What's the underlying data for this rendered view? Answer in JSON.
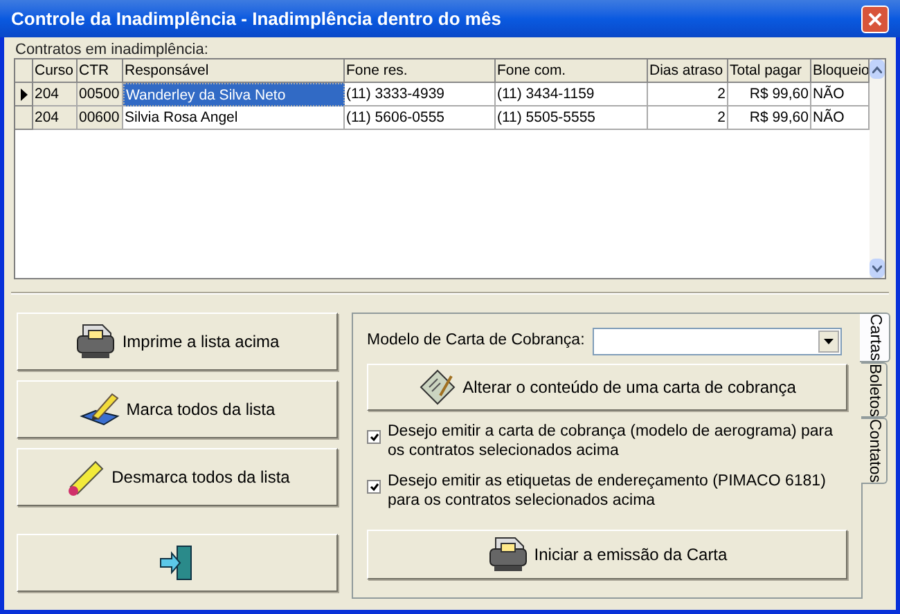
{
  "window": {
    "title": "Controle da Inadimplência - Inadimplência dentro do mês"
  },
  "grid_label": "Contratos em inadimplência:",
  "table": {
    "columns": [
      "Curso",
      "CTR",
      "Responsável",
      "Fone res.",
      "Fone com.",
      "Dias atraso",
      "Total pagar",
      "Bloqueio"
    ],
    "rows": [
      {
        "selected": true,
        "cells": [
          "204",
          "00500",
          "Wanderley da Silva Neto",
          "(11) 3333-4939",
          "(11) 3434-1159",
          "2",
          "R$ 99,60",
          "NÃO"
        ]
      },
      {
        "selected": false,
        "cells": [
          "204",
          "00600",
          "Silvia Rosa Angel",
          "(11) 5606-0555",
          "(11) 5505-5555",
          "2",
          "R$ 99,60",
          "NÃO"
        ]
      }
    ]
  },
  "left_buttons": [
    {
      "kind": "printer",
      "label": "Imprime a lista acima"
    },
    {
      "kind": "mark",
      "label": "Marca todos da lista"
    },
    {
      "kind": "pencil",
      "label": "Desmarca todos da lista"
    },
    {
      "kind": "exit"
    }
  ],
  "letter_panel": {
    "model_label": "Modelo de Carta de Cobrança:",
    "edit_button": "Alterar o conteúdo de uma carta de cobrança",
    "options": [
      {
        "label": "Desejo emitir a carta de cobrança (modelo de aerograma) para os contratos selecionados acima",
        "checked": true
      },
      {
        "label": "Desejo emitir as etiquetas de endereçamento (PIMACO 6181) para os contratos selecionados acima",
        "checked": true
      }
    ],
    "start_button": "Iniciar a emissão da Carta"
  },
  "tabs": [
    {
      "label": "Cartas",
      "selected": true
    },
    {
      "label": "Boletos",
      "selected": false
    },
    {
      "label": "Contatos",
      "selected": false
    }
  ]
}
